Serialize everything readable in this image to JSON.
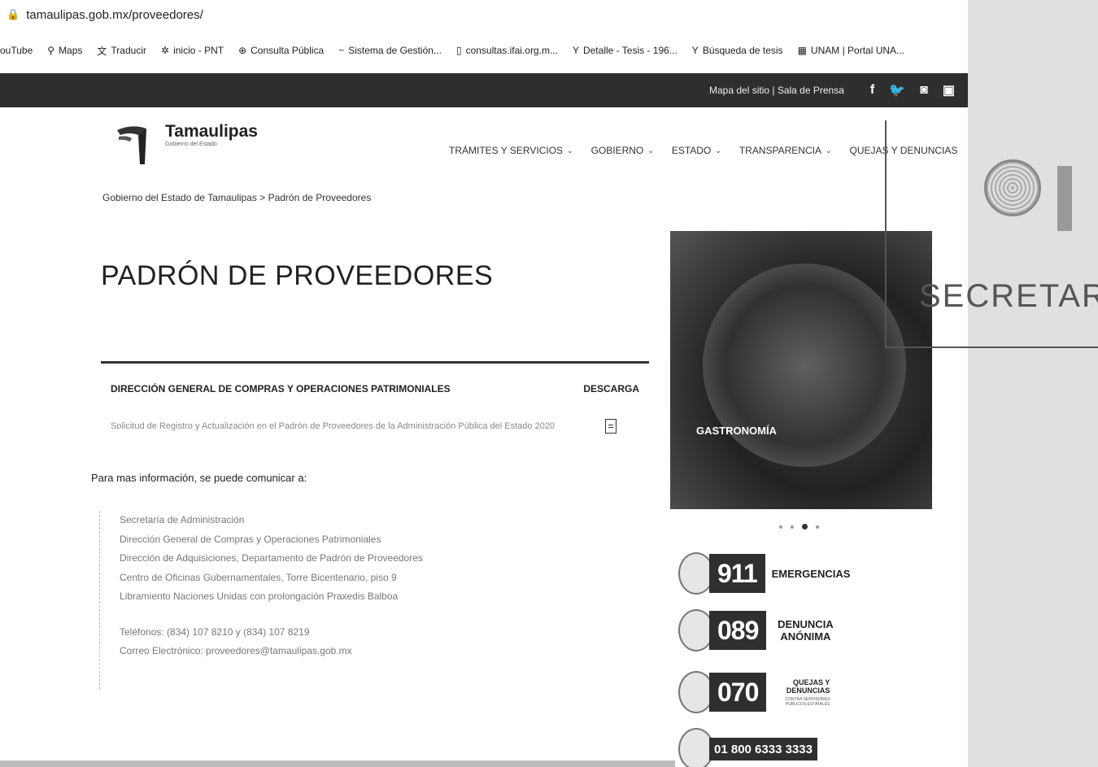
{
  "browser": {
    "url": "tamaulipas.gob.mx/proveedores/",
    "bookmarks": [
      {
        "icon": "",
        "label": "ouTube"
      },
      {
        "icon": "map-pin-icon",
        "label": "Maps"
      },
      {
        "icon": "translate-icon",
        "label": "Traducir"
      },
      {
        "icon": "pnt-icon",
        "label": "inicio - PNT"
      },
      {
        "icon": "globe-icon",
        "label": "Consulta Pública"
      },
      {
        "icon": "system-icon",
        "label": "Sistema de Gestión..."
      },
      {
        "icon": "document-icon",
        "label": "consultas.ifai.org.m..."
      },
      {
        "icon": "scj-icon",
        "label": "Detalle - Tesis - 196..."
      },
      {
        "icon": "scj-icon",
        "label": "Búsqueda de tesis"
      },
      {
        "icon": "unam-icon",
        "label": "UNAM | Portal UNA..."
      }
    ]
  },
  "topbar": {
    "links": "Mapa del sitio | Sala de Prensa",
    "social": [
      "f",
      "t",
      "ig",
      "yt"
    ]
  },
  "header": {
    "logo_name": "Tamaulipas",
    "logo_sub": "Gobierno del Estado",
    "nav": [
      {
        "label": "TRÁMITES Y SERVICIOS",
        "chevron": true
      },
      {
        "label": "GOBIERNO",
        "chevron": true
      },
      {
        "label": "ESTADO",
        "chevron": true
      },
      {
        "label": "TRANSPARENCIA",
        "chevron": true
      },
      {
        "label": "QUEJAS Y DENUNCIAS",
        "chevron": false
      }
    ]
  },
  "breadcrumb": "Gobierno del Estado de Tamaulipas > Padrón de Proveedores",
  "main": {
    "title": "PADRÓN DE PROVEEDORES",
    "table": {
      "col_name": "DIRECCIÓN GENERAL DE COMPRAS Y OPERACIONES PATRIMONIALES",
      "col_download": "DESCARGA",
      "rows": [
        {
          "name": "Solicitud de Registro y Actualización en el Padrón de Proveedores de la Administración Pública del Estado 2020"
        }
      ]
    },
    "info_lead": "Para mas información, se puede comunicar a:",
    "contact_lines": [
      "Secretaría de Administración",
      "Dirección General de Compras y Operaciones Patrimoniales",
      "Dirección de Adquisiciones, Departamento de Padrón de Proveedores",
      "Centro de Oficinas Gubernamentales, Torre Bicentenario, piso 9",
      "Libramiento Naciones Unidas con prolongación Praxedis Balboa"
    ],
    "phones": "Teléfonos: (834) 107 8210 y (834) 107 8219",
    "email": "Correo Electrónico: proveedores@tamaulipas.gob.mx"
  },
  "sidebar": {
    "gallery_label": "GASTRONOMÍA",
    "hotlines": [
      {
        "number": "911",
        "label": "EMERGENCIAS"
      },
      {
        "number": "089",
        "label": "DENUNCIA ANÓNIMA"
      },
      {
        "number": "070",
        "label": "QUEJAS Y DENUNCIAS",
        "sub": "CONTRA SERVIDORES PÚBLICOS ESTATALES"
      },
      {
        "number": "01 800 6333 3333",
        "label": ""
      }
    ]
  },
  "stamp": {
    "text": "SECRETAR"
  }
}
